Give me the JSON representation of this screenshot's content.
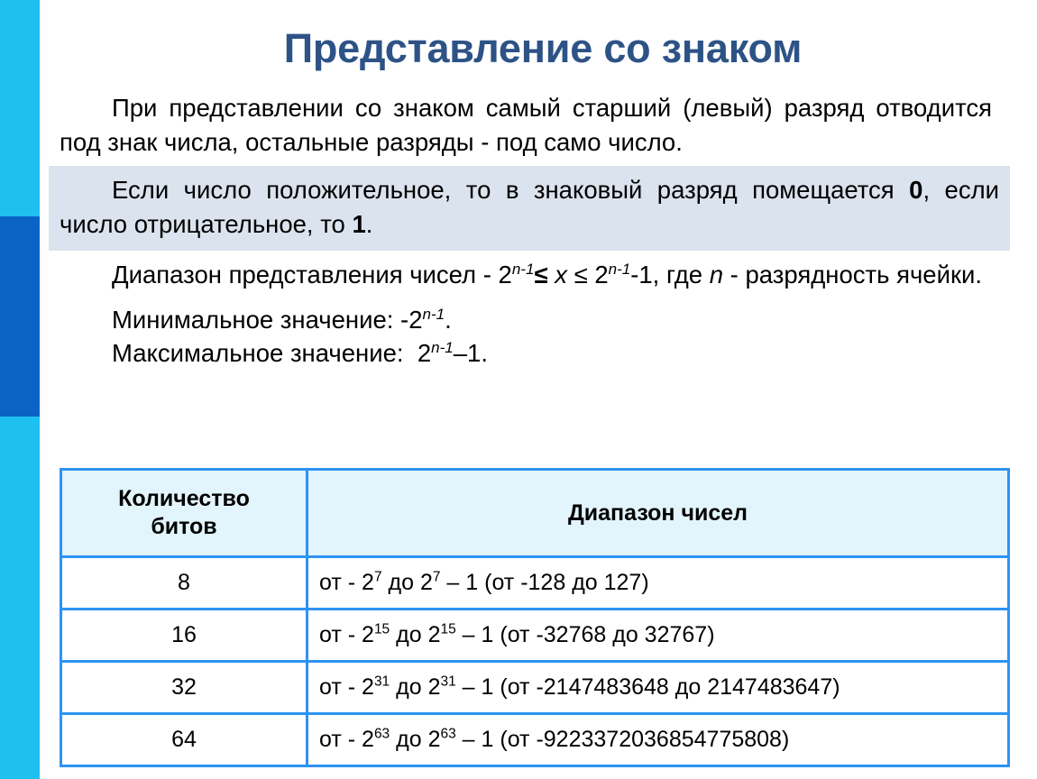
{
  "slide": {
    "title": "Представление со знаком",
    "intro_paragraph": "При представлении со знаком самый старший (левый) разряд отводится под знак числа, остальные разряды - под само число.",
    "highlight_color": "#dbe3ee",
    "accent_color": "#2d93f5",
    "sidebar_color": "#1ec0f0",
    "sidebar_accent_color": "#0b63c5",
    "title_color": "#2d5386"
  },
  "rule": {
    "prefix": "Если число положительное, то в знаковый разряд помещается ",
    "positive_bit": "0",
    "middle": ", если число отрицательное, то ",
    "negative_bit": "1",
    "suffix": "."
  },
  "range_statement": {
    "lead": "Диапазон представления чисел - 2",
    "exp_left": "n-1",
    "relation_left": "≤",
    "variable": "x",
    "relation_right": "≤",
    "base_right": "2",
    "exp_right": "n-1",
    "tail": "-1, где ",
    "var_n": "n",
    "end": " - разрядность ячейки."
  },
  "minmax": {
    "min_label": "Минимальное значение:",
    "min_value_base": "-2",
    "min_value_exp": "n-1",
    "min_value_end": ".",
    "max_label": "Максимальное значение:",
    "max_value_base": "2",
    "max_value_exp": "n-1",
    "max_value_end": "–1."
  },
  "table": {
    "headers": [
      "Количество битов",
      "Диапазон чисел"
    ],
    "header_bits_line1": "Количество",
    "header_bits_line2": "битов",
    "rows": [
      {
        "bits": "8",
        "prefix": "от - 2",
        "exp1": "7",
        "mid": " до 2",
        "exp2": "7",
        "suffix": " – 1  (от -128 до 127)"
      },
      {
        "bits": "16",
        "prefix": "от - 2",
        "exp1": "15",
        "mid": " до 2",
        "exp2": "15",
        "suffix": " – 1  (от -32768 до 32767)"
      },
      {
        "bits": "32",
        "prefix": "от - 2",
        "exp1": "31",
        "mid": " до 2",
        "exp2": "31",
        "suffix": " – 1  (от -2147483648 до 2147483647)"
      },
      {
        "bits": "64",
        "prefix": "от - 2",
        "exp1": "63",
        "mid": " до 2",
        "exp2": "63",
        "suffix": " – 1  (от -9223372036854775808)"
      }
    ]
  }
}
